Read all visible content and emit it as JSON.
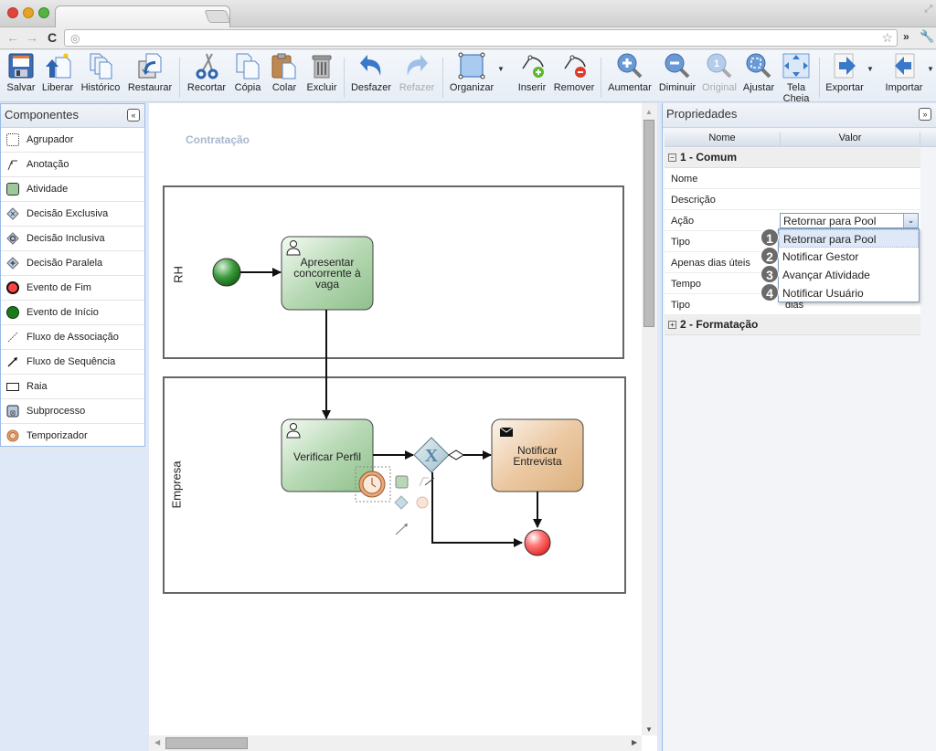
{
  "browser": {
    "tab_title": "",
    "tab_close": "×",
    "url": "",
    "nav": {
      "back": "←",
      "forward": "→",
      "reload": "C"
    },
    "more": "»"
  },
  "toolbar": {
    "buttons": [
      {
        "label": "Salvar",
        "icon": "save-icon"
      },
      {
        "label": "Liberar",
        "icon": "release-icon"
      },
      {
        "label": "Histórico",
        "icon": "history-icon"
      },
      {
        "label": "Restaurar",
        "icon": "restore-icon"
      },
      {
        "label": "Recortar",
        "icon": "scissors-icon"
      },
      {
        "label": "Cópia",
        "icon": "copy-icon"
      },
      {
        "label": "Colar",
        "icon": "paste-icon"
      },
      {
        "label": "Excluir",
        "icon": "trash-icon"
      },
      {
        "label": "Desfazer",
        "icon": "undo-icon"
      },
      {
        "label": "Refazer",
        "icon": "redo-icon",
        "disabled": true
      },
      {
        "label": "Organizar",
        "icon": "arrange-icon"
      },
      {
        "label": "Inserir",
        "icon": "insert-point-icon"
      },
      {
        "label": "Remover",
        "icon": "remove-point-icon"
      },
      {
        "label": "Aumentar",
        "icon": "zoom-in-icon"
      },
      {
        "label": "Diminuir",
        "icon": "zoom-out-icon"
      },
      {
        "label": "Original",
        "icon": "zoom-original-icon",
        "disabled": true
      },
      {
        "label": "Ajustar",
        "icon": "zoom-fit-icon"
      },
      {
        "label": "Tela Cheia",
        "icon": "fullscreen-icon"
      },
      {
        "label": "Exportar",
        "icon": "export-icon"
      },
      {
        "label": "Importar",
        "icon": "import-icon"
      }
    ]
  },
  "components": {
    "title": "Componentes",
    "collapse": "«",
    "items": [
      {
        "label": "Agrupador",
        "icon": "group-icon"
      },
      {
        "label": "Anotação",
        "icon": "annotation-icon"
      },
      {
        "label": "Atividade",
        "icon": "activity-icon"
      },
      {
        "label": "Decisão Exclusiva",
        "icon": "exclusive-gateway-icon"
      },
      {
        "label": "Decisão Inclusiva",
        "icon": "inclusive-gateway-icon"
      },
      {
        "label": "Decisão Paralela",
        "icon": "parallel-gateway-icon"
      },
      {
        "label": "Evento de Fim",
        "icon": "end-event-icon"
      },
      {
        "label": "Evento de Início",
        "icon": "start-event-icon"
      },
      {
        "label": "Fluxo de Associação",
        "icon": "association-flow-icon"
      },
      {
        "label": "Fluxo de Sequência",
        "icon": "sequence-flow-icon"
      },
      {
        "label": "Raia",
        "icon": "lane-icon"
      },
      {
        "label": "Subprocesso",
        "icon": "subprocess-icon"
      },
      {
        "label": "Temporizador",
        "icon": "timer-icon"
      }
    ]
  },
  "diagram": {
    "process_name": "Contratação",
    "lanes": [
      {
        "label": "RH"
      },
      {
        "label": "Empresa"
      }
    ],
    "tasks": [
      {
        "label": "Apresentar concorrente à vaga",
        "type": "user"
      },
      {
        "label": "Verificar Perfil",
        "type": "user"
      },
      {
        "label": "Notificar Entrevista",
        "type": "message"
      }
    ],
    "gateway": "X"
  },
  "properties": {
    "title": "Propriedades",
    "expand": "»",
    "col_name": "Nome",
    "col_value": "Valor",
    "groups": [
      {
        "label": "1 - Comum",
        "toggle": "−"
      },
      {
        "label": "2 - Formatação",
        "toggle": "+"
      }
    ],
    "rows": [
      {
        "name": "Nome",
        "value": ""
      },
      {
        "name": "Descrição",
        "value": ""
      },
      {
        "name": "Ação",
        "value": ""
      },
      {
        "name": "Tipo",
        "value": ""
      },
      {
        "name": "Apenas dias úteis",
        "value": ""
      },
      {
        "name": "Tempo",
        "value": ""
      },
      {
        "name": "Tipo",
        "value": "dias"
      }
    ],
    "action_select": {
      "value": "Retornar para Pool",
      "options": [
        "Retornar para Pool",
        "Notificar Gestor",
        "Avançar Atividade",
        "Notificar Usuário"
      ],
      "badges": [
        "1",
        "2",
        "3",
        "4"
      ]
    }
  }
}
